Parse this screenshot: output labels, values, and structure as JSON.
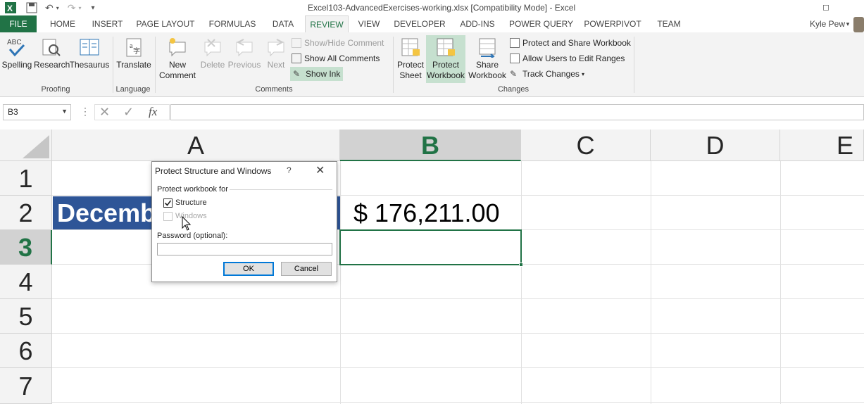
{
  "app": {
    "title": "Excel103-AdvancedExercises-working.xlsx  [Compatibility Mode] - Excel",
    "user": "Kyle Pew"
  },
  "tabs": [
    "FILE",
    "HOME",
    "INSERT",
    "PAGE LAYOUT",
    "FORMULAS",
    "DATA",
    "REVIEW",
    "VIEW",
    "DEVELOPER",
    "ADD-INS",
    "POWER QUERY",
    "POWERPIVOT",
    "TEAM"
  ],
  "ribbon": {
    "proofing": {
      "spelling": "Spelling",
      "research": "Research",
      "thesaurus": "Thesaurus",
      "group": "Proofing"
    },
    "language": {
      "translate": "Translate",
      "group": "Language"
    },
    "comments": {
      "new_comment_1": "New",
      "new_comment_2": "Comment",
      "delete": "Delete",
      "previous": "Previous",
      "next": "Next",
      "show_hide": "Show/Hide Comment",
      "show_all": "Show All Comments",
      "show_ink": "Show Ink",
      "group": "Comments"
    },
    "changes": {
      "protect_sheet_1": "Protect",
      "protect_sheet_2": "Sheet",
      "protect_workbook_1": "Protect",
      "protect_workbook_2": "Workbook",
      "share_workbook_1": "Share",
      "share_workbook_2": "Workbook",
      "protect_share": "Protect and Share Workbook",
      "allow_users": "Allow Users to Edit Ranges",
      "track_changes": "Track Changes",
      "group": "Changes"
    }
  },
  "formula_bar": {
    "name_box": "B3",
    "fx": "fx",
    "value": ""
  },
  "sheet": {
    "columns": [
      "A",
      "B",
      "C",
      "D",
      "E"
    ],
    "rows": [
      "1",
      "2",
      "3",
      "4",
      "5",
      "6",
      "7"
    ],
    "selected_cell": "B3",
    "a2": "December",
    "b2": "$ 176,211.00"
  },
  "dialog": {
    "title": "Protect Structure and Windows",
    "help": "?",
    "close": "✕",
    "section": "Protect workbook for",
    "structure_label": "Structure",
    "structure_checked": true,
    "windows_label": "Windows",
    "windows_enabled": false,
    "password_label": "Password (optional):",
    "password_value": "",
    "ok": "OK",
    "cancel": "Cancel"
  },
  "colors": {
    "excel_green": "#217346",
    "header_blue": "#2e5597",
    "highlight": "#c6e0cf"
  }
}
